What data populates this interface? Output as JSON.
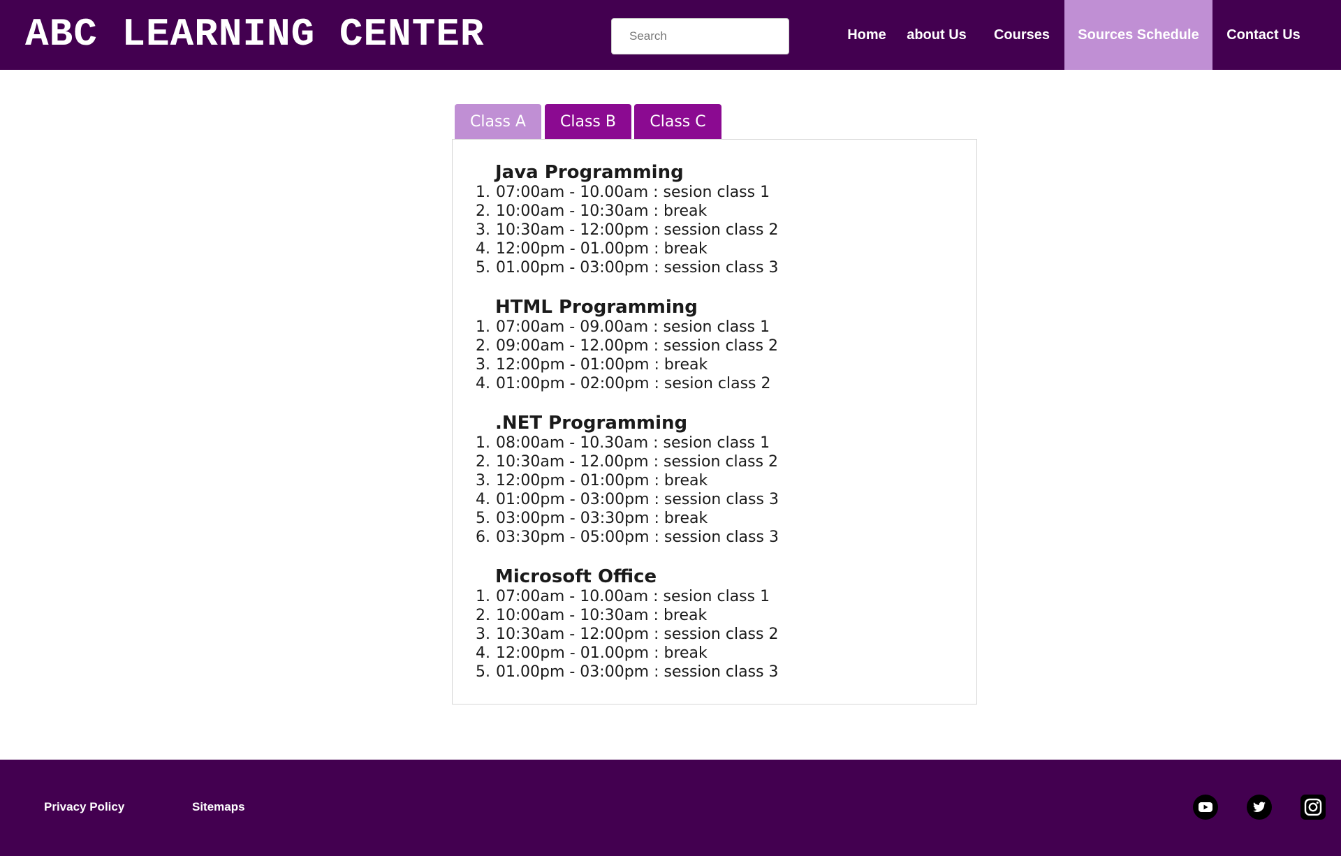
{
  "header": {
    "logo": "ABC LEARNING CENTER",
    "search_placeholder": "Search",
    "nav": [
      {
        "label": "Home"
      },
      {
        "label": "about Us"
      },
      {
        "label": "Courses"
      },
      {
        "label": "Sources Schedule",
        "active": true
      },
      {
        "label": "Contact Us"
      }
    ]
  },
  "tabs": [
    {
      "label": "Class A",
      "active": true
    },
    {
      "label": "Class B"
    },
    {
      "label": "Class C"
    }
  ],
  "courses": [
    {
      "title": "Java Programming",
      "sessions": [
        "07:00am - 10.00am : sesion class 1",
        "10:00am - 10:30am : break",
        "10:30am - 12:00pm : session class 2",
        "12:00pm - 01.00pm : break",
        "01.00pm - 03:00pm : session class 3"
      ]
    },
    {
      "title": "HTML Programming",
      "sessions": [
        "07:00am - 09.00am : sesion class 1",
        "09:00am - 12.00pm : session class 2",
        "12:00pm - 01:00pm : break",
        "01:00pm - 02:00pm : sesion class 2"
      ]
    },
    {
      "title": ".NET Programming",
      "sessions": [
        "08:00am - 10.30am : sesion class 1",
        "10:30am - 12.00pm : session class 2",
        "12:00pm - 01:00pm : break",
        "01:00pm - 03:00pm : session class 3",
        "03:00pm - 03:30pm : break",
        "03:30pm - 05:00pm : session class 3"
      ]
    },
    {
      "title": "Microsoft Office",
      "sessions": [
        "07:00am - 10.00am : sesion class 1",
        "10:00am - 10:30am : break",
        "10:30am - 12:00pm : session class 2",
        "12:00pm - 01.00pm : break",
        "01.00pm - 03:00pm : session class 3"
      ]
    }
  ],
  "footer": {
    "links": [
      {
        "label": "Privacy Policy"
      },
      {
        "label": "Sitemaps"
      }
    ],
    "social": [
      {
        "icon": "youtube-icon"
      },
      {
        "icon": "twitter-icon"
      },
      {
        "icon": "instagram-icon"
      }
    ]
  },
  "colors": {
    "header_bg": "#430050",
    "active_nav_bg": "#c08fd4",
    "tab_bg": "#8b0a91",
    "tab_active_bg": "#c08fd4",
    "footer_bg": "#430050"
  }
}
